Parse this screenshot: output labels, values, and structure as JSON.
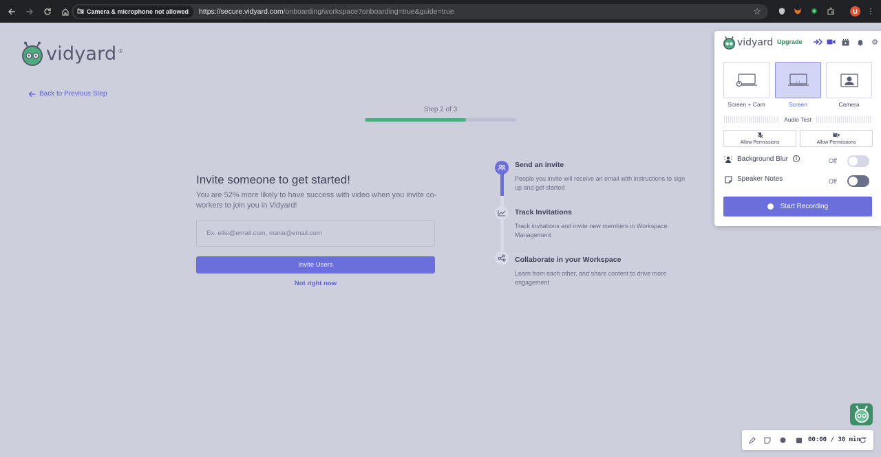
{
  "browser": {
    "permission_chip": "Camera & microphone not allowed",
    "url_host": "https://secure.vidyard.com",
    "url_path": "/onboarding/workspace?onboarding=true&guide=true",
    "profile_initial": "U"
  },
  "page": {
    "logo_text": "vidyard",
    "back_link": "Back to Previous Step",
    "step_label": "Step 2 of 3",
    "progress_percent": 67,
    "invite": {
      "title": "Invite someone to get started!",
      "description": "You are 52% more likely to have success with video when you invite co-workers to join you in Vidyard!",
      "email_placeholder": "Ex. ellis@email.com, maria@email.com",
      "invite_button": "Invite Users",
      "skip_link": "Not right now"
    },
    "steps": [
      {
        "title": "Send an invite",
        "text": "People you invite will receive an email with instructions to sign up and get started",
        "icon": "users-icon",
        "state": "active"
      },
      {
        "title": "Track Invitations",
        "text": "Track invitations and invite new members in Workspace Management",
        "icon": "chart-icon",
        "state": "idle"
      },
      {
        "title": "Collaborate in your Workspace",
        "text": "Learn from each other, and share content to drive more engagement",
        "icon": "network-icon",
        "state": "idle"
      }
    ]
  },
  "recorder": {
    "logo_text": "vidyard",
    "upgrade": "Upgrade",
    "modes": [
      {
        "label": "Screen + Cam",
        "selected": false
      },
      {
        "label": "Screen",
        "selected": true
      },
      {
        "label": "Camera",
        "selected": false
      }
    ],
    "audio_test": "Audio Test",
    "permissions": [
      {
        "label": "Allow Permissions",
        "icon": "mic-off-icon"
      },
      {
        "label": "Allow Permissions",
        "icon": "camera-off-icon"
      }
    ],
    "background_blur": {
      "label": "Background Blur",
      "state": "Off"
    },
    "speaker_notes": {
      "label": "Speaker Notes",
      "state": "Off"
    },
    "start_button": "Start Recording"
  },
  "recording_bar": {
    "time": "00:00 / 30 min"
  },
  "colors": {
    "accent": "#6b6fdc",
    "progress": "#4cad7d",
    "background": "#cdcfdd",
    "brand_green": "#3d8f6a"
  }
}
